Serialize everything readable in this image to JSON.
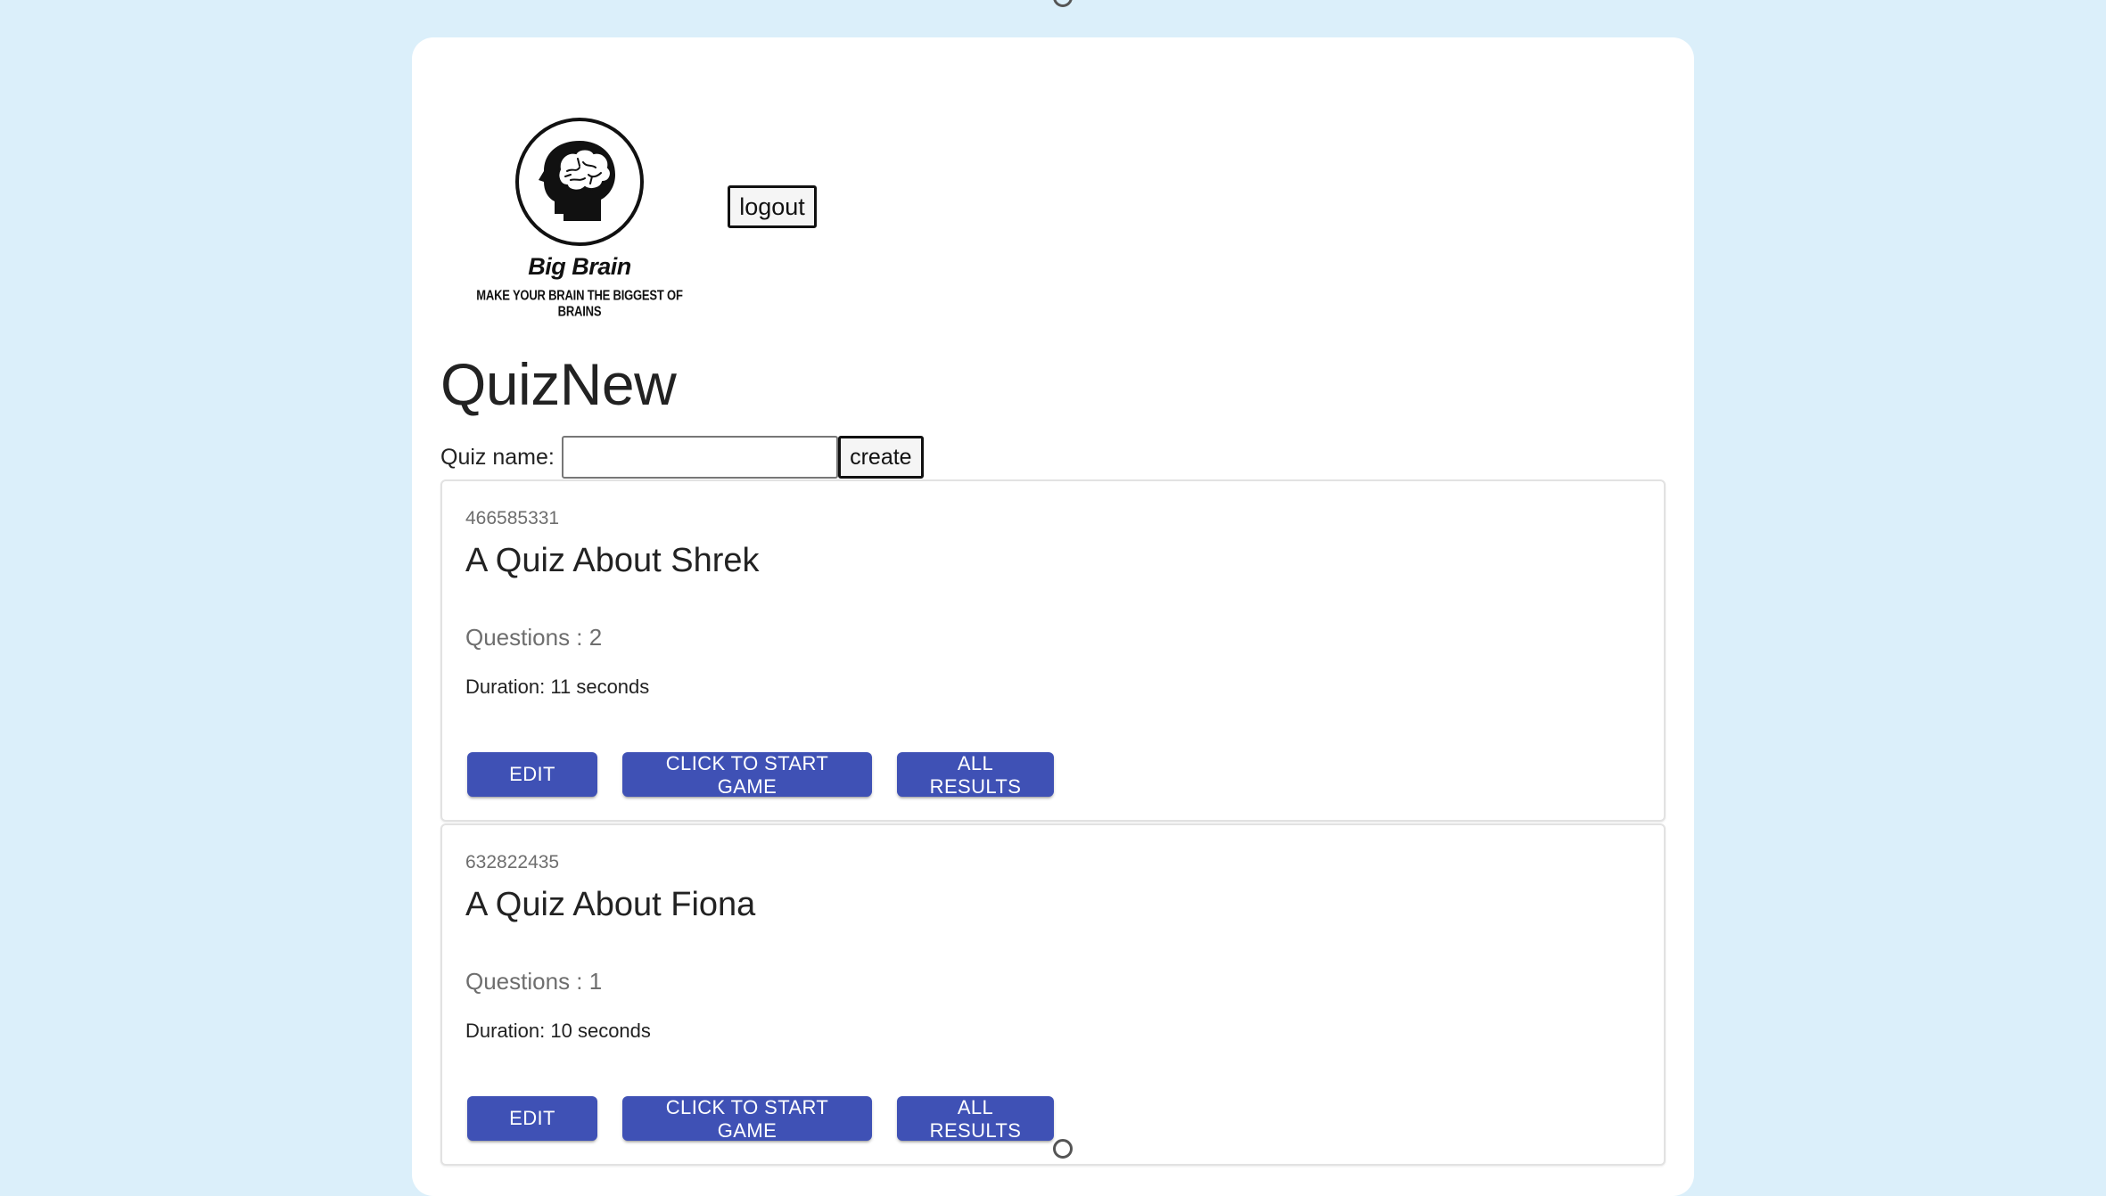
{
  "header": {
    "logo": {
      "icon": "brain-head-icon",
      "name": "Big Brain",
      "tagline": "MAKE YOUR BRAIN THE BIGGEST OF BRAINS"
    },
    "logout_label": "logout"
  },
  "page": {
    "title": "QuizNew"
  },
  "form": {
    "label": "Quiz name:",
    "value": "",
    "placeholder": "",
    "create_label": "create"
  },
  "quizzes": [
    {
      "id": "466585331",
      "title": "A Quiz About Shrek",
      "questions": "Questions : 2",
      "duration": "Duration: 11 seconds",
      "edit_label": "EDIT",
      "start_label": "CLICK TO START GAME",
      "results_label": "ALL RESULTS"
    },
    {
      "id": "632822435",
      "title": "A Quiz About Fiona",
      "questions": "Questions : 1",
      "duration": "Duration: 10 seconds",
      "edit_label": "EDIT",
      "start_label": "CLICK TO START GAME",
      "results_label": "ALL RESULTS"
    }
  ],
  "colors": {
    "background": "#dbeffa",
    "panel": "#ffffff",
    "primary_button": "#3f51b5"
  }
}
